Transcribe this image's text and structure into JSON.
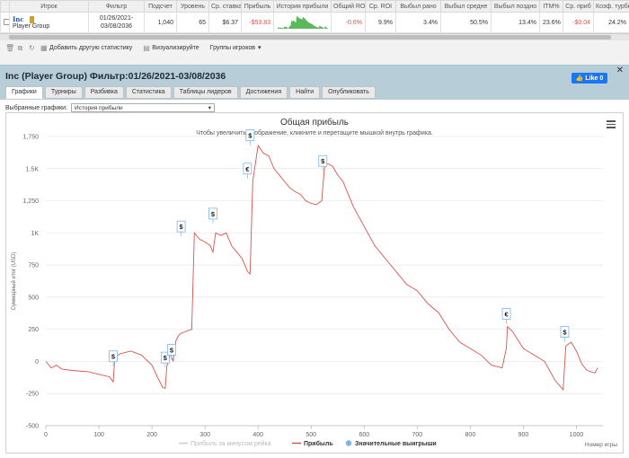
{
  "table": {
    "headers": [
      "",
      "Игрок",
      "Фильтр",
      "Подсчет",
      "Уровень",
      "Ср. ставка",
      "Прибыль",
      "История прибыли",
      "Общий ROI",
      "Ср. ROI",
      "Выбыл рано",
      "Выбыл средне",
      "Выбыл поздно",
      "ITM%",
      "Ср. приб",
      "Коэф. турбо"
    ],
    "row": {
      "player_name": "Inc",
      "player_group": "Player Group",
      "filter": "01/26/2021-03/08/2036",
      "count": "1,040",
      "level": "65",
      "avg_stake": "$6.37",
      "profit": "-$53.83",
      "overall_roi": "-0.6%",
      "avg_roi": "9.9%",
      "early": "3.4%",
      "middle": "50.5%",
      "late": "13.4%",
      "itm": "23.6%",
      "avg_profit": "-$0.04",
      "turbo": "24.2%"
    }
  },
  "toolbar": {
    "add_stats": "Добавить другую статистику",
    "visualize": "Визуализируйте",
    "player_groups": "Группы игроков"
  },
  "panel": {
    "title": "Inc (Player Group) Фильтр:01/26/2021-03/08/2036",
    "like_label": "Like 0",
    "tabs": [
      "Графики",
      "Турниры",
      "Разбивка",
      "Статистика",
      "Таблицы лидеров",
      "Достижения",
      "Найти",
      "Опубликовать"
    ],
    "select_label": "Выбранные графики:",
    "select_value": "История прибыли"
  },
  "colors": {
    "profit_line": "#d9534f",
    "rake_line": "#cccccc",
    "marker_fill": "#7cb5ec",
    "history_bar": "#5cb85c"
  },
  "chart_data": {
    "type": "line",
    "title": "Общая прибыль",
    "subtitle": "Чтобы увеличить изображение, кликните и перетащите мышкой внутрь графика.",
    "xlabel": "Номер игры",
    "ylabel": "Суммарный итог (USD)",
    "xlim": [
      0,
      1050
    ],
    "ylim": [
      -500,
      1750
    ],
    "x_ticks": [
      "0",
      "100",
      "200",
      "300",
      "400",
      "500",
      "600",
      "700",
      "800",
      "900",
      "1000"
    ],
    "y_ticks": [
      "-500",
      "-250",
      "0",
      "250",
      "500",
      "750",
      "1K",
      "1,250",
      "1.5K",
      "1,750"
    ],
    "legend": [
      "Прибыль за минусом рейка",
      "Прибыль",
      "Значительные выигрыши"
    ],
    "series": [
      {
        "name": "Прибыль",
        "x": [
          0,
          10,
          20,
          30,
          50,
          80,
          100,
          120,
          127,
          130,
          140,
          160,
          180,
          200,
          210,
          220,
          225,
          228,
          235,
          240,
          245,
          250,
          255,
          275,
          280,
          290,
          300,
          310,
          315,
          320,
          330,
          340,
          350,
          360,
          370,
          380,
          385,
          390,
          400,
          410,
          420,
          430,
          440,
          450,
          460,
          470,
          480,
          490,
          500,
          510,
          520,
          525,
          530,
          540,
          550,
          560,
          570,
          580,
          600,
          620,
          640,
          660,
          680,
          700,
          720,
          740,
          760,
          780,
          800,
          820,
          840,
          860,
          868,
          870,
          880,
          900,
          920,
          940,
          960,
          975,
          980,
          990,
          1000,
          1010,
          1020,
          1035,
          1040
        ],
        "y": [
          0,
          -50,
          -30,
          -60,
          -70,
          -80,
          -100,
          -120,
          -160,
          30,
          60,
          80,
          50,
          -30,
          -120,
          -200,
          -210,
          -40,
          60,
          0,
          160,
          200,
          220,
          250,
          1000,
          950,
          930,
          900,
          850,
          1000,
          980,
          1000,
          900,
          850,
          800,
          700,
          680,
          1400,
          1680,
          1620,
          1600,
          1500,
          1450,
          1400,
          1350,
          1320,
          1300,
          1250,
          1230,
          1220,
          1250,
          1500,
          1540,
          1520,
          1450,
          1400,
          1300,
          1200,
          1050,
          900,
          800,
          700,
          600,
          550,
          450,
          380,
          250,
          150,
          100,
          50,
          -30,
          -50,
          100,
          270,
          230,
          100,
          50,
          0,
          -150,
          -220,
          120,
          150,
          80,
          -20,
          -70,
          -90,
          -50
        ]
      }
    ],
    "markers": [
      {
        "x": 127,
        "y": 40,
        "label": "$"
      },
      {
        "x": 225,
        "y": 30,
        "label": "$"
      },
      {
        "x": 237,
        "y": 90,
        "label": "$"
      },
      {
        "x": 255,
        "y": 1050,
        "label": "$"
      },
      {
        "x": 315,
        "y": 1150,
        "label": "$"
      },
      {
        "x": 380,
        "y": 1500,
        "label": "€"
      },
      {
        "x": 385,
        "y": 1760,
        "label": "$"
      },
      {
        "x": 522,
        "y": 1560,
        "label": "$"
      },
      {
        "x": 868,
        "y": 370,
        "label": "€"
      },
      {
        "x": 978,
        "y": 230,
        "label": "$"
      }
    ]
  }
}
